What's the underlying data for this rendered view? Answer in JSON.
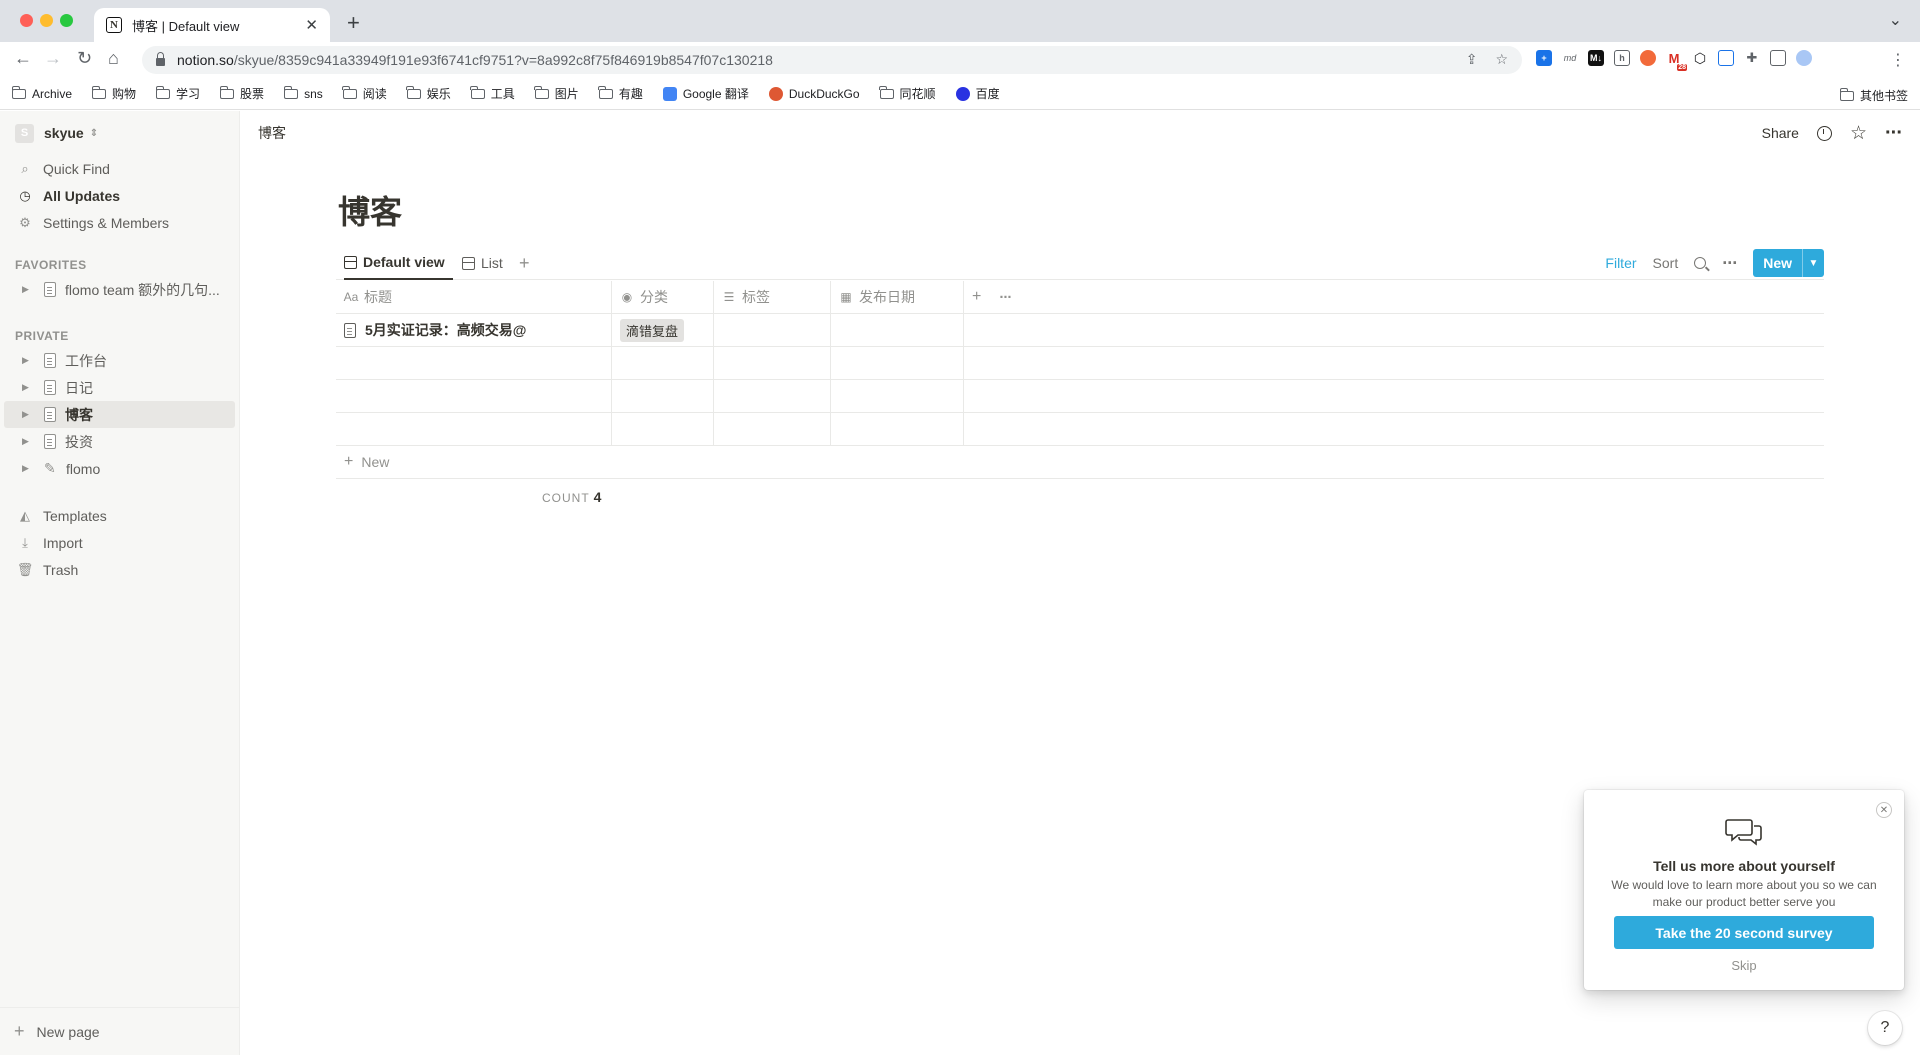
{
  "browser": {
    "tab_title": "博客 | Default view",
    "url_host": "notion.so",
    "url_path": "/skyue/8359c941a33949f191e93f6741cf9751?v=8a992c8f75f846919b8547f07c130218",
    "badge_count": "28"
  },
  "bookmarks": {
    "items": [
      "Archive",
      "购物",
      "学习",
      "股票",
      "sns",
      "阅读",
      "娱乐",
      "工具",
      "图片",
      "有趣"
    ],
    "google_translate": "Google 翻译",
    "duckduckgo": "DuckDuckGo",
    "tonghuashun": "同花顺",
    "baidu": "百度",
    "other": "其他书签"
  },
  "sidebar": {
    "workspace_initial": "S",
    "workspace_name": "skyue",
    "links": {
      "quick_find": "Quick Find",
      "all_updates": "All Updates",
      "settings": "Settings & Members"
    },
    "favorites_label": "FAVORITES",
    "favorites": [
      "flomo team 额外的几句..."
    ],
    "private_label": "PRIVATE",
    "private_pages": [
      "工作台",
      "日记",
      "博客",
      "投资",
      "flomo"
    ],
    "templates": "Templates",
    "import": "Import",
    "trash": "Trash",
    "new_page": "New page"
  },
  "topbar": {
    "breadcrumb": "博客",
    "share": "Share"
  },
  "page": {
    "title": "博客",
    "views": {
      "default": "Default view",
      "list": "List"
    },
    "actions": {
      "filter": "Filter",
      "sort": "Sort",
      "new": "New"
    },
    "columns": {
      "title": "标题",
      "category": "分类",
      "tags": "标签",
      "date": "发布日期"
    },
    "rows": [
      {
        "title": "5月实证记录：高频交易@",
        "category": "滴错复盘",
        "tags": "",
        "date": ""
      },
      {
        "title": "",
        "category": "",
        "tags": "",
        "date": ""
      },
      {
        "title": "",
        "category": "",
        "tags": "",
        "date": ""
      },
      {
        "title": "",
        "category": "",
        "tags": "",
        "date": ""
      }
    ],
    "new_row": "New",
    "count_label": "COUNT",
    "count_value": "4"
  },
  "survey": {
    "title": "Tell us more about yourself",
    "body": "We would love to learn more about you so we can make our product better serve you",
    "button": "Take the 20 second survey",
    "skip": "Skip"
  },
  "help": "?",
  "colors": {
    "accent": "#2eaadc",
    "sidebar_bg": "#f7f7f5",
    "text": "#37352f"
  }
}
